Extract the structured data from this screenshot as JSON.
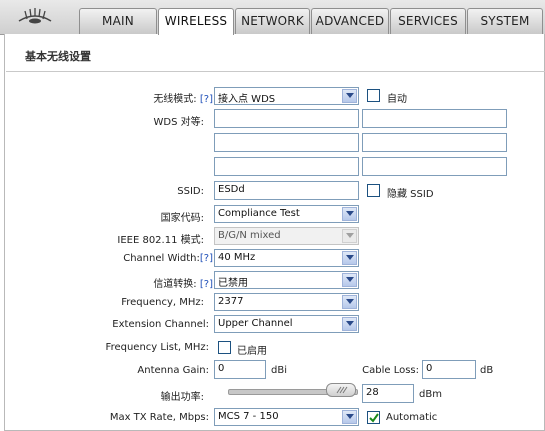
{
  "nav": {
    "tabs": [
      {
        "label": "MAIN",
        "active": false
      },
      {
        "label": "WIRELESS",
        "active": true
      },
      {
        "label": "NETWORK",
        "active": false
      },
      {
        "label": "ADVANCED",
        "active": false
      },
      {
        "label": "SERVICES",
        "active": false
      },
      {
        "label": "SYSTEM",
        "active": false
      }
    ]
  },
  "section": {
    "title": "基本无线设置"
  },
  "form": {
    "wireless_mode": {
      "label": "无线模式:",
      "help": "[?]",
      "value": "接入点 WDS",
      "auto_label": "自动",
      "auto_checked": false
    },
    "wds_peers": {
      "label": "WDS 对等:",
      "values": [
        "",
        "",
        "",
        "",
        "",
        ""
      ]
    },
    "ssid": {
      "label": "SSID:",
      "value": "ESDd",
      "hide_label": "隐藏 SSID",
      "hide_checked": false
    },
    "country_code": {
      "label": "国家代码:",
      "value": "Compliance Test"
    },
    "ieee_mode": {
      "label": "IEEE 802.11 模式:",
      "value": "B/G/N mixed"
    },
    "channel_width": {
      "label": "Channel Width:",
      "help": "[?]",
      "value": "40 MHz"
    },
    "channel_shift": {
      "label": "信道转换:",
      "help": "[?]",
      "value": "已禁用"
    },
    "frequency": {
      "label": "Frequency, MHz:",
      "value": "2377"
    },
    "extension_channel": {
      "label": "Extension Channel:",
      "value": "Upper Channel"
    },
    "frequency_list": {
      "label": "Frequency List, MHz:",
      "enabled_label": "已启用",
      "checked": false
    },
    "antenna_gain": {
      "label": "Antenna Gain:",
      "value": "0",
      "unit": "dBi"
    },
    "cable_loss": {
      "label": "Cable Loss:",
      "value": "0",
      "unit": "dB"
    },
    "output_power": {
      "label": "输出功率:",
      "value": "28",
      "unit": "dBm",
      "slider_fraction": 0.92
    },
    "max_tx_rate": {
      "label": "Max TX Rate, Mbps:",
      "value": "MCS 7 - 150",
      "automatic_label": "Automatic",
      "automatic_checked": true
    }
  }
}
